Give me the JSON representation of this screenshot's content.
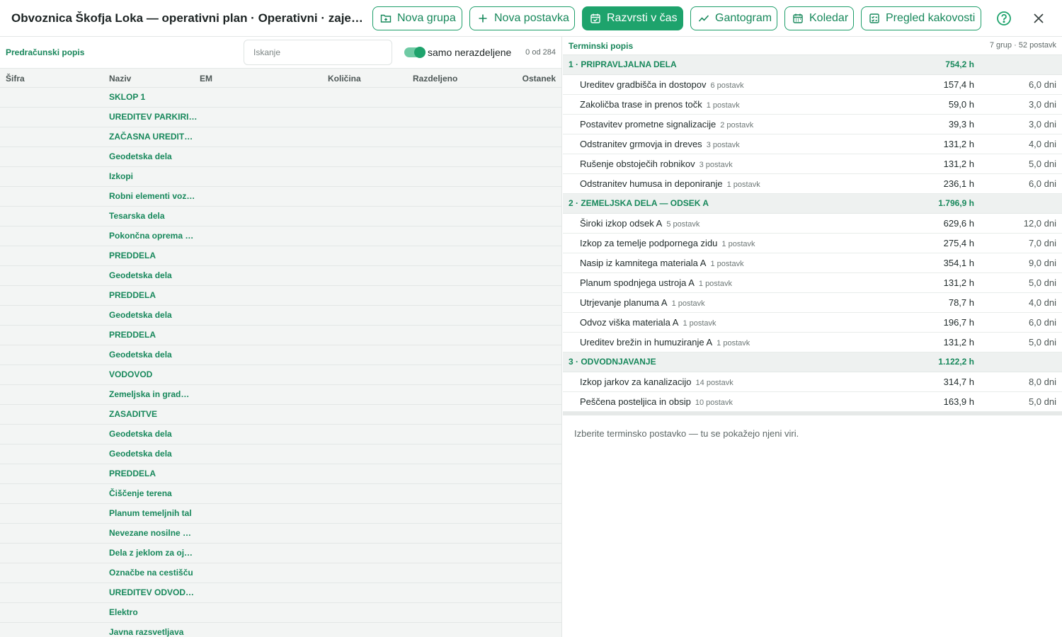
{
  "header": {
    "title": "Obvoznica Škofja Loka — operativni plan · Operativni · zajeto …",
    "buttons": {
      "new_group": "Nova grupa",
      "new_item": "Nova postavka",
      "schedule": "Razvrsti v čas",
      "gantt": "Gantogram",
      "calendar": "Koledar",
      "quality": "Pregled kakovosti"
    }
  },
  "left": {
    "title": "Predračunski popis",
    "search_placeholder": "Iskanje",
    "toggle_label": "samo nerazdeljene",
    "count": "0 od 284",
    "columns": [
      "Šifra",
      "Naziv",
      "EM",
      "Količina",
      "Razdeljeno",
      "Ostanek"
    ],
    "rows": [
      "SKLOP 1",
      "UREDITEV PARKIRI…",
      "ZAČASNA UREDIT…",
      "Geodetska dela",
      "Izkopi",
      "Robni elementi voz…",
      "Tesarska dela",
      "Pokončna oprema …",
      "PREDDELA",
      "Geodetska dela",
      "PREDDELA",
      "Geodetska dela",
      "PREDDELA",
      "Geodetska dela",
      "VODOVOD",
      "Zemeljska in grad…",
      "ZASADITVE",
      "Geodetska dela",
      "Geodetska dela",
      "PREDDELA",
      "Čiščenje terena",
      "Planum temeljnih tal",
      "Nevezane nosilne …",
      "Dela z jeklom za oj…",
      "Označbe na cestišču",
      "UREDITEV ODVOD…",
      "Elektro",
      "Javna razsvetljava"
    ]
  },
  "right": {
    "title": "Terminski popis",
    "meta": "7 grup · 52 postavk",
    "groups": [
      {
        "name": "1 · PRIPRAVLJALNA DELA",
        "hours": "754,2 h",
        "items": [
          {
            "name": "Ureditev gradbišča in dostopov",
            "count": "6 postavk",
            "hours": "157,4 h",
            "days": "6,0 dni"
          },
          {
            "name": "Zakoličba trase in prenos točk",
            "count": "1 postavk",
            "hours": "59,0 h",
            "days": "3,0 dni"
          },
          {
            "name": "Postavitev prometne signalizacije",
            "count": "2 postavk",
            "hours": "39,3 h",
            "days": "3,0 dni"
          },
          {
            "name": "Odstranitev grmovja in dreves",
            "count": "3 postavk",
            "hours": "131,2 h",
            "days": "4,0 dni"
          },
          {
            "name": "Rušenje obstoječih robnikov",
            "count": "3 postavk",
            "hours": "131,2 h",
            "days": "5,0 dni"
          },
          {
            "name": "Odstranitev humusa in deponiranje",
            "count": "1 postavk",
            "hours": "236,1 h",
            "days": "6,0 dni"
          }
        ]
      },
      {
        "name": "2 · ZEMELJSKA DELA — ODSEK A",
        "hours": "1.796,9 h",
        "items": [
          {
            "name": "Široki izkop odsek A",
            "count": "5 postavk",
            "hours": "629,6 h",
            "days": "12,0 dni"
          },
          {
            "name": "Izkop za temelje podpornega zidu",
            "count": "1 postavk",
            "hours": "275,4 h",
            "days": "7,0 dni"
          },
          {
            "name": "Nasip iz kamnitega materiala A",
            "count": "1 postavk",
            "hours": "354,1 h",
            "days": "9,0 dni"
          },
          {
            "name": "Planum spodnjega ustroja A",
            "count": "1 postavk",
            "hours": "131,2 h",
            "days": "5,0 dni"
          },
          {
            "name": "Utrjevanje planuma A",
            "count": "1 postavk",
            "hours": "78,7 h",
            "days": "4,0 dni"
          },
          {
            "name": "Odvoz viška materiala A",
            "count": "1 postavk",
            "hours": "196,7 h",
            "days": "6,0 dni"
          },
          {
            "name": "Ureditev brežin in humuziranje A",
            "count": "1 postavk",
            "hours": "131,2 h",
            "days": "5,0 dni"
          }
        ]
      },
      {
        "name": "3 · ODVODNJAVANJE",
        "hours": "1.122,2 h",
        "items": [
          {
            "name": "Izkop jarkov za kanalizacijo",
            "count": "14 postavk",
            "hours": "314,7 h",
            "days": "8,0 dni"
          },
          {
            "name": "Peščena posteljica in obsip",
            "count": "10 postavk",
            "hours": "163,9 h",
            "days": "5,0 dni"
          }
        ]
      }
    ],
    "hint": "Izberite terminsko postavko — tu se pokažejo njeni viri."
  },
  "colors": {
    "accent": "#1ea36c",
    "accent_text": "#17885b"
  }
}
